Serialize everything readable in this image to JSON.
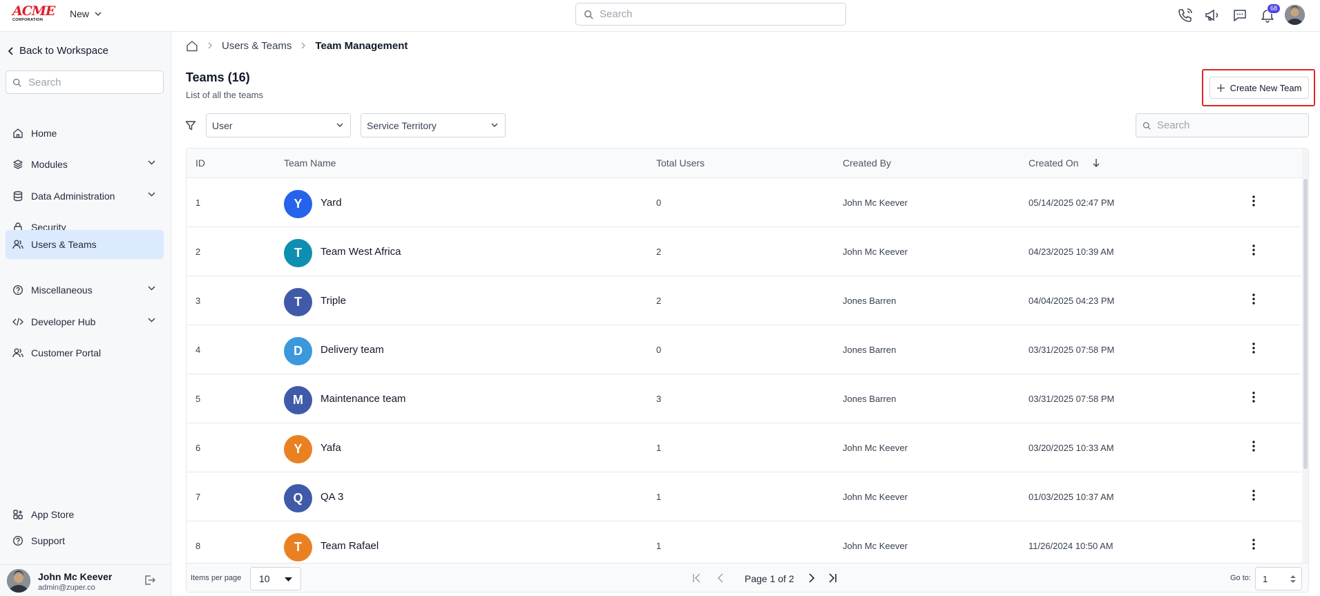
{
  "topbar": {
    "logo_big": "ACME",
    "logo_small": "CORPORATION",
    "new_label": "New",
    "search_placeholder": "Search",
    "notification_count": "68"
  },
  "sidebar": {
    "back_label": "Back to Workspace",
    "search_placeholder": "Search",
    "items": [
      {
        "label": "Home",
        "icon": "home-icon"
      },
      {
        "label": "Modules",
        "icon": "layers-icon",
        "expandable": true
      },
      {
        "label": "Data Administration",
        "icon": "database-icon",
        "expandable": true
      },
      {
        "label": "Security",
        "icon": "lock-icon"
      },
      {
        "label": "Users & Teams",
        "icon": "users-icon",
        "active": true
      },
      {
        "label": "Miscellaneous",
        "icon": "help-circle-icon",
        "expandable": true
      },
      {
        "label": "Developer Hub",
        "icon": "code-icon",
        "expandable": true
      },
      {
        "label": "Customer Portal",
        "icon": "users-icon"
      }
    ],
    "bottom_items": [
      {
        "label": "App Store",
        "icon": "app-store-icon"
      },
      {
        "label": "Support",
        "icon": "help-circle-icon"
      }
    ],
    "user": {
      "name": "John Mc Keever",
      "email": "admin@zuper.co"
    }
  },
  "main": {
    "breadcrumb": [
      "Users & Teams",
      "Team Management"
    ],
    "title": "Teams (16)",
    "subtitle": "List of all the teams",
    "create_label": "Create New Team",
    "filters": {
      "user_label": "User",
      "territory_label": "Service Territory"
    },
    "search_placeholder": "Search",
    "table": {
      "headers": {
        "id": "ID",
        "name": "Team Name",
        "users": "Total Users",
        "created_by": "Created By",
        "created_on": "Created On"
      },
      "rows": [
        {
          "id": "1",
          "initial": "Y",
          "name": "Yard",
          "users": "0",
          "created_by": "John Mc Keever",
          "created_on": "05/14/2025 02:47 PM",
          "color": "#2563eb"
        },
        {
          "id": "2",
          "initial": "T",
          "name": "Team West Africa",
          "users": "2",
          "created_by": "John Mc Keever",
          "created_on": "04/23/2025 10:39 AM",
          "color": "#0e8fb0"
        },
        {
          "id": "3",
          "initial": "T",
          "name": "Triple",
          "users": "2",
          "created_by": "Jones Barren",
          "created_on": "04/04/2025 04:23 PM",
          "color": "#3f5aa8"
        },
        {
          "id": "4",
          "initial": "D",
          "name": "Delivery team",
          "users": "0",
          "created_by": "Jones Barren",
          "created_on": "03/31/2025 07:58 PM",
          "color": "#3b98db"
        },
        {
          "id": "5",
          "initial": "M",
          "name": "Maintenance team",
          "users": "3",
          "created_by": "Jones Barren",
          "created_on": "03/31/2025 07:58 PM",
          "color": "#3f5aa8"
        },
        {
          "id": "6",
          "initial": "Y",
          "name": "Yafa",
          "users": "1",
          "created_by": "John Mc Keever",
          "created_on": "03/20/2025 10:33 AM",
          "color": "#e98122"
        },
        {
          "id": "7",
          "initial": "Q",
          "name": "QA 3",
          "users": "1",
          "created_by": "John Mc Keever",
          "created_on": "01/03/2025 10:37 AM",
          "color": "#3f5aa8"
        },
        {
          "id": "8",
          "initial": "T",
          "name": "Team Rafael",
          "users": "1",
          "created_by": "John Mc Keever",
          "created_on": "11/26/2024 10:50 AM",
          "color": "#e98122"
        }
      ]
    },
    "footer": {
      "items_per_page_label": "Items per page",
      "items_per_page": "10",
      "page_text": "Page 1 of 2",
      "goto_label": "Go to:",
      "goto_value": "1"
    }
  }
}
